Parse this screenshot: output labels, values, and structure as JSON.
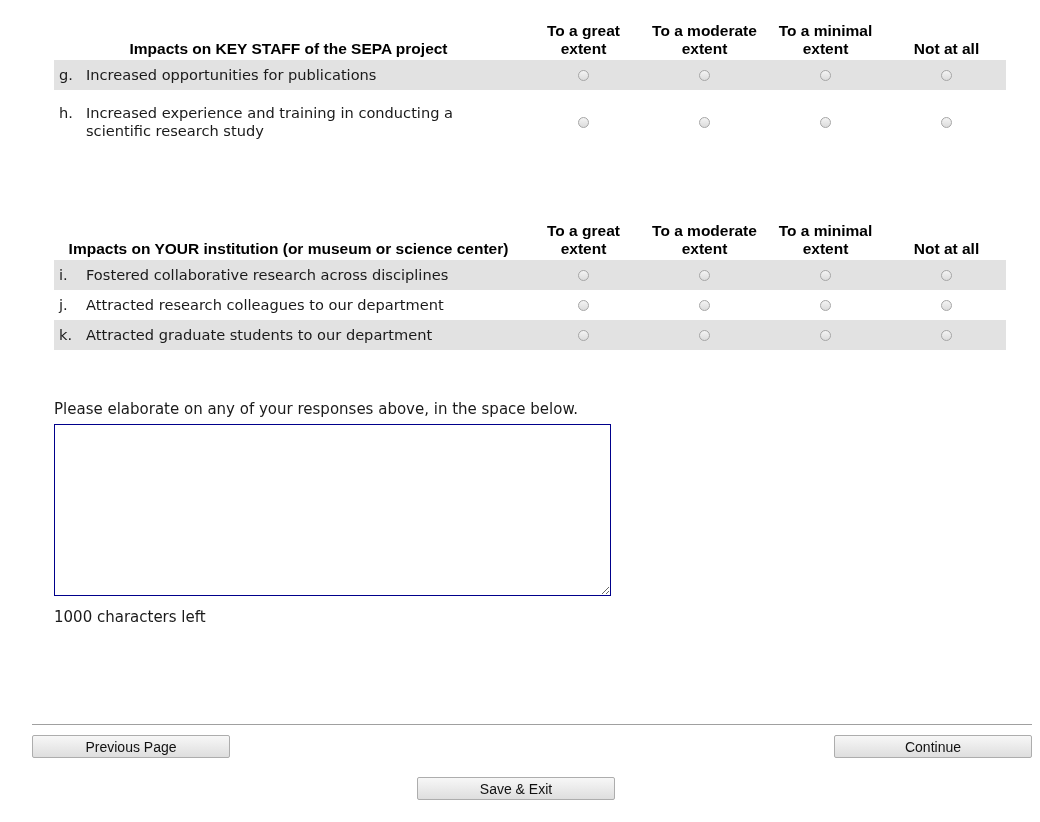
{
  "sections": [
    {
      "heading": "Impacts on KEY STAFF of the SEPA project",
      "columns": [
        "To a great extent",
        "To a moderate extent",
        "To a minimal extent",
        "Not at all"
      ],
      "rows": [
        {
          "letter": "g.",
          "text": "Increased opportunities for publications",
          "choices": [
            {
              "selected": false
            },
            {
              "selected": false
            },
            {
              "selected": false
            },
            {
              "selected": false
            }
          ]
        },
        {
          "letter": "h.",
          "text": "Increased experience and training in conducting a scientific research study",
          "choices": [
            {
              "selected": false
            },
            {
              "selected": false
            },
            {
              "selected": false
            },
            {
              "selected": false
            }
          ]
        }
      ]
    },
    {
      "heading": "Impacts on YOUR institution (or museum or science center)",
      "columns": [
        "To a great extent",
        "To a moderate extent",
        "To a minimal extent",
        "Not at all"
      ],
      "rows": [
        {
          "letter": "i.",
          "text": "Fostered collaborative research across disciplines",
          "choices": [
            {
              "selected": false
            },
            {
              "selected": false
            },
            {
              "selected": false
            },
            {
              "selected": false
            }
          ]
        },
        {
          "letter": "j.",
          "text": "Attracted research colleagues to our department",
          "choices": [
            {
              "selected": false
            },
            {
              "selected": false
            },
            {
              "selected": false
            },
            {
              "selected": false
            }
          ]
        },
        {
          "letter": "k.",
          "text": "Attracted graduate students to our department",
          "choices": [
            {
              "selected": false
            },
            {
              "selected": false
            },
            {
              "selected": false
            },
            {
              "selected": false
            }
          ]
        }
      ]
    }
  ],
  "elaborate": {
    "prompt": "Please elaborate on any of your responses above, in the space below.",
    "counter": "1000 characters left"
  },
  "nav": {
    "previous": "Previous Page",
    "continue": "Continue",
    "save": "Save & Exit"
  }
}
